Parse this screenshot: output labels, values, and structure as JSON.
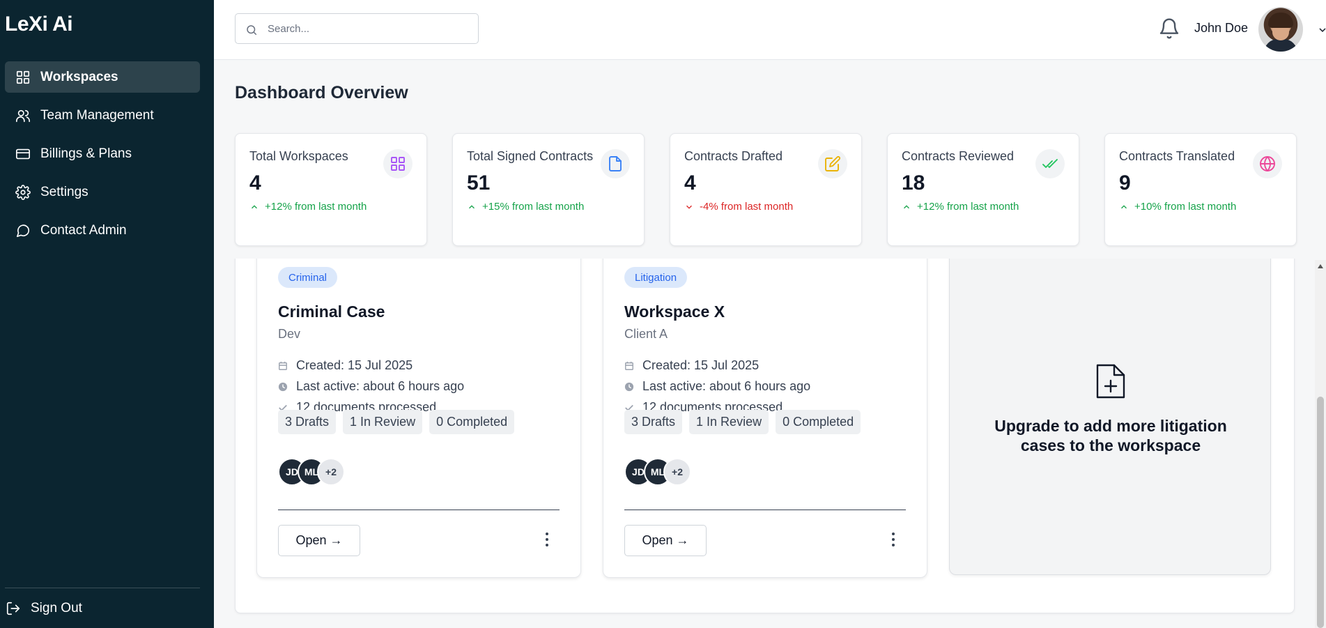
{
  "app": {
    "name": "LeXi Ai"
  },
  "sidebar": {
    "items": [
      {
        "label": "Workspaces",
        "icon": "grid-icon",
        "active": true
      },
      {
        "label": "Team Management",
        "icon": "users-icon"
      },
      {
        "label": "Billings & Plans",
        "icon": "credit-card-icon"
      },
      {
        "label": "Settings",
        "icon": "gear-icon"
      },
      {
        "label": "Contact Admin",
        "icon": "message-circle-icon"
      }
    ],
    "sign_out": "Sign Out"
  },
  "header": {
    "search_placeholder": "Search...",
    "user_name": "John Doe"
  },
  "page_title": "Dashboard Overview",
  "stats": [
    {
      "label": "Total Workspaces",
      "value": "4",
      "trend": "+12% from last month",
      "direction": "up",
      "icon": "grid-icon",
      "color": "#a855f7"
    },
    {
      "label": "Total Signed Contracts",
      "value": "51",
      "trend": "+15% from last month",
      "direction": "up",
      "icon": "file-icon",
      "color": "#3b82f6"
    },
    {
      "label": "Contracts Drafted",
      "value": "4",
      "trend": "-4% from last month",
      "direction": "down",
      "icon": "edit-icon",
      "color": "#eab308"
    },
    {
      "label": "Contracts Reviewed",
      "value": "18",
      "trend": "+12% from last month",
      "direction": "up",
      "icon": "double-check-icon",
      "color": "#22c55e"
    },
    {
      "label": "Contracts Translated",
      "value": "9",
      "trend": "+10% from last month",
      "direction": "up",
      "icon": "globe-icon",
      "color": "#ec4899"
    }
  ],
  "workspaces": [
    {
      "tag": "Criminal",
      "title": "Criminal Case",
      "client": "Dev",
      "created": "Created: 15 Jul 2025",
      "last_active": "Last active: about 6 hours ago",
      "documents": "12 documents processed",
      "pills": [
        "3 Drafts",
        "1 In Review",
        "0 Completed"
      ],
      "members": [
        "JD",
        "ML",
        "+2"
      ],
      "open_label": "Open →"
    },
    {
      "tag": "Litigation",
      "title": "Workspace X",
      "client": "Client A",
      "created": "Created: 15 Jul 2025",
      "last_active": "Last active: about 6 hours ago",
      "documents": "12 documents processed",
      "pills": [
        "3 Drafts",
        "1 In Review",
        "0 Completed"
      ],
      "members": [
        "JD",
        "ML",
        "+2"
      ],
      "open_label": "Open →"
    }
  ],
  "upgrade": {
    "text": "Upgrade to add more litigation cases to the workspace",
    "icon": "file-plus-icon"
  }
}
